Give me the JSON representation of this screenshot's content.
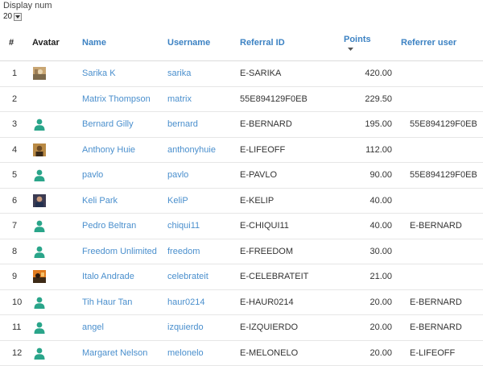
{
  "display": {
    "label": "Display num",
    "value": "20"
  },
  "columns": {
    "index": "#",
    "avatar": "Avatar",
    "name": "Name",
    "username": "Username",
    "referral_id": "Referral ID",
    "points": "Points",
    "referrer": "Referrer user"
  },
  "colors": {
    "link": "#4a8fcd",
    "header_link": "#3c82c3",
    "avatar_default": "#2aa58a"
  },
  "rows": [
    {
      "index": "1",
      "avatar": "photo-landscape",
      "name": "Sarika K",
      "username": "sarika",
      "referral_id": "E-SARIKA",
      "points": "420.00",
      "referrer": ""
    },
    {
      "index": "2",
      "avatar": "none",
      "name": "Matrix Thompson",
      "username": "matrix",
      "referral_id": "55E894129F0EB",
      "points": "229.50",
      "referrer": ""
    },
    {
      "index": "3",
      "avatar": "default-user",
      "name": "Bernard Gilly",
      "username": "bernard",
      "referral_id": "E-BERNARD",
      "points": "195.00",
      "referrer": "55E894129F0EB"
    },
    {
      "index": "4",
      "avatar": "photo-person",
      "name": "Anthony Huie",
      "username": "anthonyhuie",
      "referral_id": "E-LIFEOFF",
      "points": "112.00",
      "referrer": ""
    },
    {
      "index": "5",
      "avatar": "default-user",
      "name": "pavlo",
      "username": "pavlo",
      "referral_id": "E-PAVLO",
      "points": "90.00",
      "referrer": "55E894129F0EB"
    },
    {
      "index": "6",
      "avatar": "photo-dark",
      "name": "Keli Park",
      "username": "KeliP",
      "referral_id": "E-KELIP",
      "points": "40.00",
      "referrer": ""
    },
    {
      "index": "7",
      "avatar": "default-user",
      "name": "Pedro Beltran",
      "username": "chiqui11",
      "referral_id": "E-CHIQUI11",
      "points": "40.00",
      "referrer": "E-BERNARD"
    },
    {
      "index": "8",
      "avatar": "default-user",
      "name": "Freedom Unlimited",
      "username": "freedom",
      "referral_id": "E-FREEDOM",
      "points": "30.00",
      "referrer": ""
    },
    {
      "index": "9",
      "avatar": "photo-orange",
      "name": "Italo Andrade",
      "username": "celebrateit",
      "referral_id": "E-CELEBRATEIT",
      "points": "21.00",
      "referrer": ""
    },
    {
      "index": "10",
      "avatar": "default-user",
      "name": "Tih Haur Tan",
      "username": "haur0214",
      "referral_id": "E-HAUR0214",
      "points": "20.00",
      "referrer": "E-BERNARD"
    },
    {
      "index": "11",
      "avatar": "default-user",
      "name": "angel",
      "username": "izquierdo",
      "referral_id": "E-IZQUIERDO",
      "points": "20.00",
      "referrer": "E-BERNARD"
    },
    {
      "index": "12",
      "avatar": "default-user",
      "name": "Margaret Nelson",
      "username": "melonelo",
      "referral_id": "E-MELONELO",
      "points": "20.00",
      "referrer": "E-LIFEOFF"
    }
  ]
}
